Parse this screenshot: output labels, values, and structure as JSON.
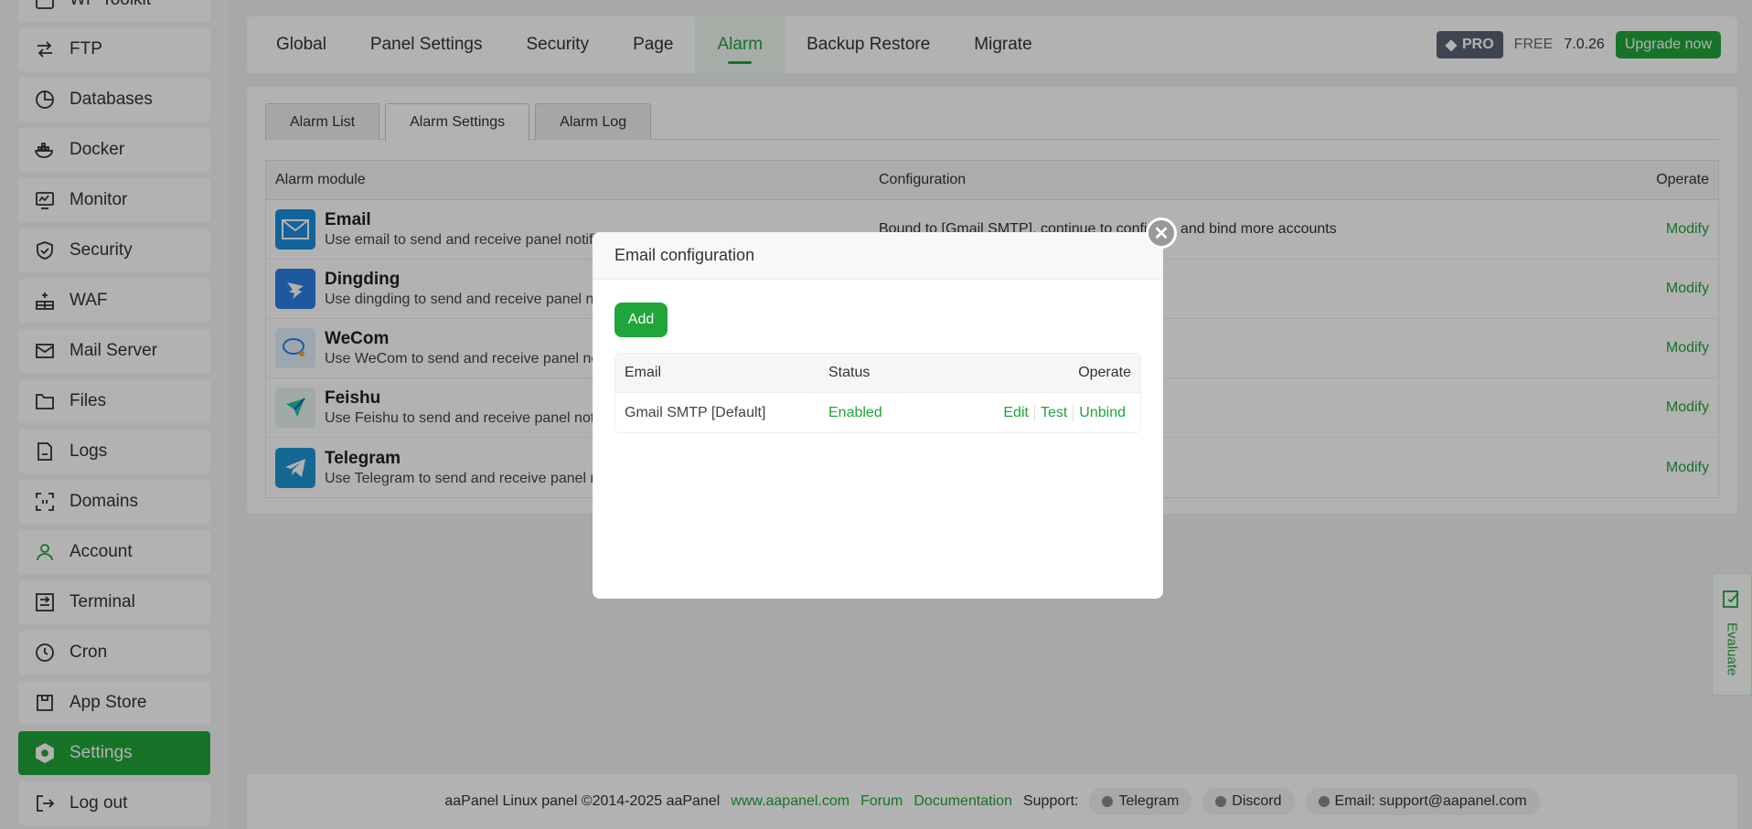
{
  "sidebar": {
    "items": [
      {
        "label": "WP Toolkit",
        "icon": "wordpress-icon"
      },
      {
        "label": "FTP",
        "icon": "ftp-icon"
      },
      {
        "label": "Databases",
        "icon": "database-icon"
      },
      {
        "label": "Docker",
        "icon": "docker-icon"
      },
      {
        "label": "Monitor",
        "icon": "monitor-icon"
      },
      {
        "label": "Security",
        "icon": "shield-icon"
      },
      {
        "label": "WAF",
        "icon": "waf-icon"
      },
      {
        "label": "Mail Server",
        "icon": "mail-icon"
      },
      {
        "label": "Files",
        "icon": "folder-icon"
      },
      {
        "label": "Logs",
        "icon": "logs-icon"
      },
      {
        "label": "Domains",
        "icon": "domains-icon"
      },
      {
        "label": "Account",
        "icon": "account-icon"
      },
      {
        "label": "Terminal",
        "icon": "terminal-icon"
      },
      {
        "label": "Cron",
        "icon": "clock-icon"
      },
      {
        "label": "App Store",
        "icon": "app-store-icon"
      },
      {
        "label": "Settings",
        "icon": "settings-icon"
      },
      {
        "label": "Log out",
        "icon": "logout-icon"
      }
    ]
  },
  "topnav": {
    "tabs": [
      "Global",
      "Panel Settings",
      "Security",
      "Page",
      "Alarm",
      "Backup Restore",
      "Migrate"
    ],
    "pro": "PRO",
    "free": "FREE",
    "version": "7.0.26",
    "upgrade": "Upgrade now"
  },
  "subtabs": [
    "Alarm List",
    "Alarm Settings",
    "Alarm Log"
  ],
  "alarm_table": {
    "headers": {
      "module": "Alarm module",
      "config": "Configuration",
      "operate": "Operate"
    },
    "rows": [
      {
        "name": "Email",
        "desc": "Use email to send and receive panel notifications",
        "config": "Bound to [Gmail SMTP], continue to configure and bind more accounts",
        "op": "Modify"
      },
      {
        "name": "Dingding",
        "desc": "Use dingding to send and receive panel notifications",
        "config": "",
        "op": "Modify"
      },
      {
        "name": "WeCom",
        "desc": "Use WeCom to send and receive panel notifications",
        "config": "",
        "op": "Modify"
      },
      {
        "name": "Feishu",
        "desc": "Use Feishu to send and receive panel notifications",
        "config": "",
        "op": "Modify"
      },
      {
        "name": "Telegram",
        "desc": "Use Telegram to send and receive panel notifications",
        "config": "",
        "op": "Modify"
      }
    ]
  },
  "footer": {
    "copyright": "aaPanel Linux panel ©2014-2025 aaPanel",
    "site": "www.aapanel.com",
    "forum": "Forum",
    "docs": "Documentation",
    "support": "Support:",
    "telegram": "Telegram",
    "discord": "Discord",
    "email": "Email: support@aapanel.com"
  },
  "evaluate": "Evaluate",
  "modal": {
    "title": "Email configuration",
    "add": "Add",
    "headers": {
      "email": "Email",
      "status": "Status",
      "operate": "Operate"
    },
    "rows": [
      {
        "email": "Gmail SMTP [Default]",
        "status": "Enabled",
        "edit": "Edit",
        "test": "Test",
        "unbind": "Unbind"
      }
    ]
  },
  "colors": {
    "accent": "#20a53a"
  }
}
